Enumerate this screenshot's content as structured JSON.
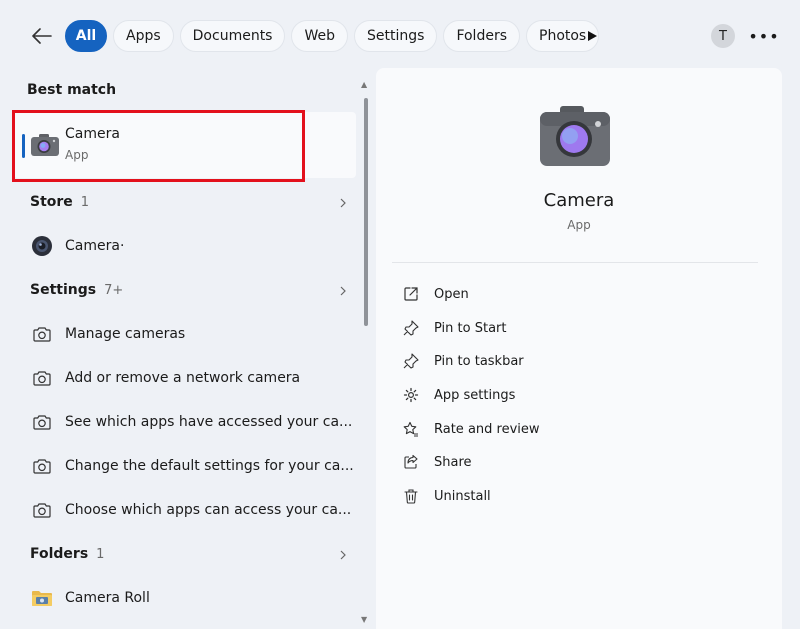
{
  "filters": [
    "All",
    "Apps",
    "Documents",
    "Web",
    "Settings",
    "Folders",
    "Photos"
  ],
  "user_initial": "T",
  "more_label": "•••",
  "best_match": {
    "heading": "Best match",
    "title": "Camera",
    "subtitle": "App"
  },
  "store": {
    "heading": "Store",
    "count": "1",
    "items": [
      "Camera·"
    ]
  },
  "settings": {
    "heading": "Settings",
    "count": "7+",
    "items": [
      "Manage cameras",
      "Add or remove a network camera",
      "See which apps have accessed your ca...",
      "Change the default settings for your ca...",
      "Choose which apps can access your ca..."
    ]
  },
  "folders": {
    "heading": "Folders",
    "count": "1",
    "items": [
      "Camera Roll"
    ]
  },
  "details": {
    "name": "Camera",
    "type": "App",
    "actions": [
      "Open",
      "Pin to Start",
      "Pin to taskbar",
      "App settings",
      "Rate and review",
      "Share",
      "Uninstall"
    ]
  },
  "colors": {
    "accent": "#1563c0",
    "highlight": "#e3101c"
  }
}
